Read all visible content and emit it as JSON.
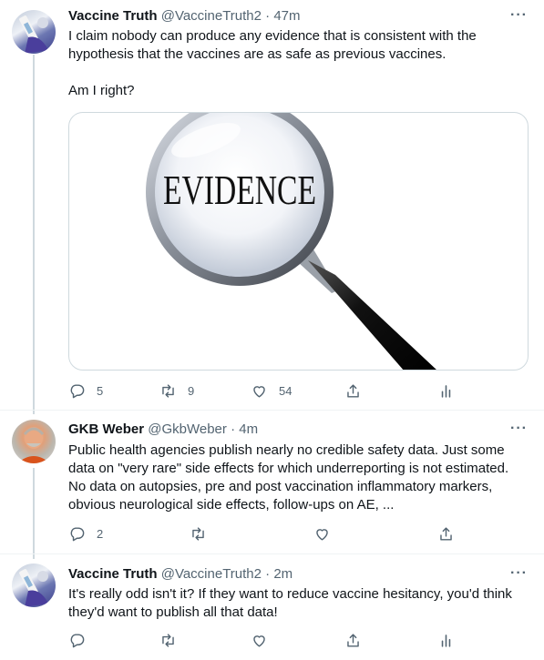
{
  "tweets": [
    {
      "name": "Vaccine Truth",
      "handle": "@VaccineTruth2",
      "separator": "·",
      "time": "47m",
      "text": "I claim nobody can produce any evidence that is consistent with the hypothesis that the vaccines are as safe as previous vaccines.\n\nAm I right?",
      "media_text": "EVIDENCE",
      "actions": {
        "reply_count": "5",
        "retweet_count": "9",
        "like_count": "54"
      }
    },
    {
      "name": "GKB Weber",
      "handle": "@GkbWeber",
      "separator": "·",
      "time": "4m",
      "text": "Public health agencies publish nearly no credible safety data. Just some data on \"very rare\" side effects for which underreporting is not estimated. No data on autopsies, pre and post vaccination inflammatory markers, obvious neurological side effects, follow-ups on AE, ...",
      "actions": {
        "reply_count": "2"
      }
    },
    {
      "name": "Vaccine Truth",
      "handle": "@VaccineTruth2",
      "separator": "·",
      "time": "2m",
      "text": "It's really odd isn't it? If they want to reduce vaccine hesitancy, you'd think they'd want to publish all that data!"
    }
  ],
  "more_label": "···",
  "colors": {
    "text": "#0f1419",
    "secondary": "#536471",
    "divider": "#eff3f4",
    "thread": "#cfd9de"
  },
  "icons": [
    "reply-icon",
    "retweet-icon",
    "like-icon",
    "share-icon",
    "analytics-icon",
    "more-icon"
  ]
}
